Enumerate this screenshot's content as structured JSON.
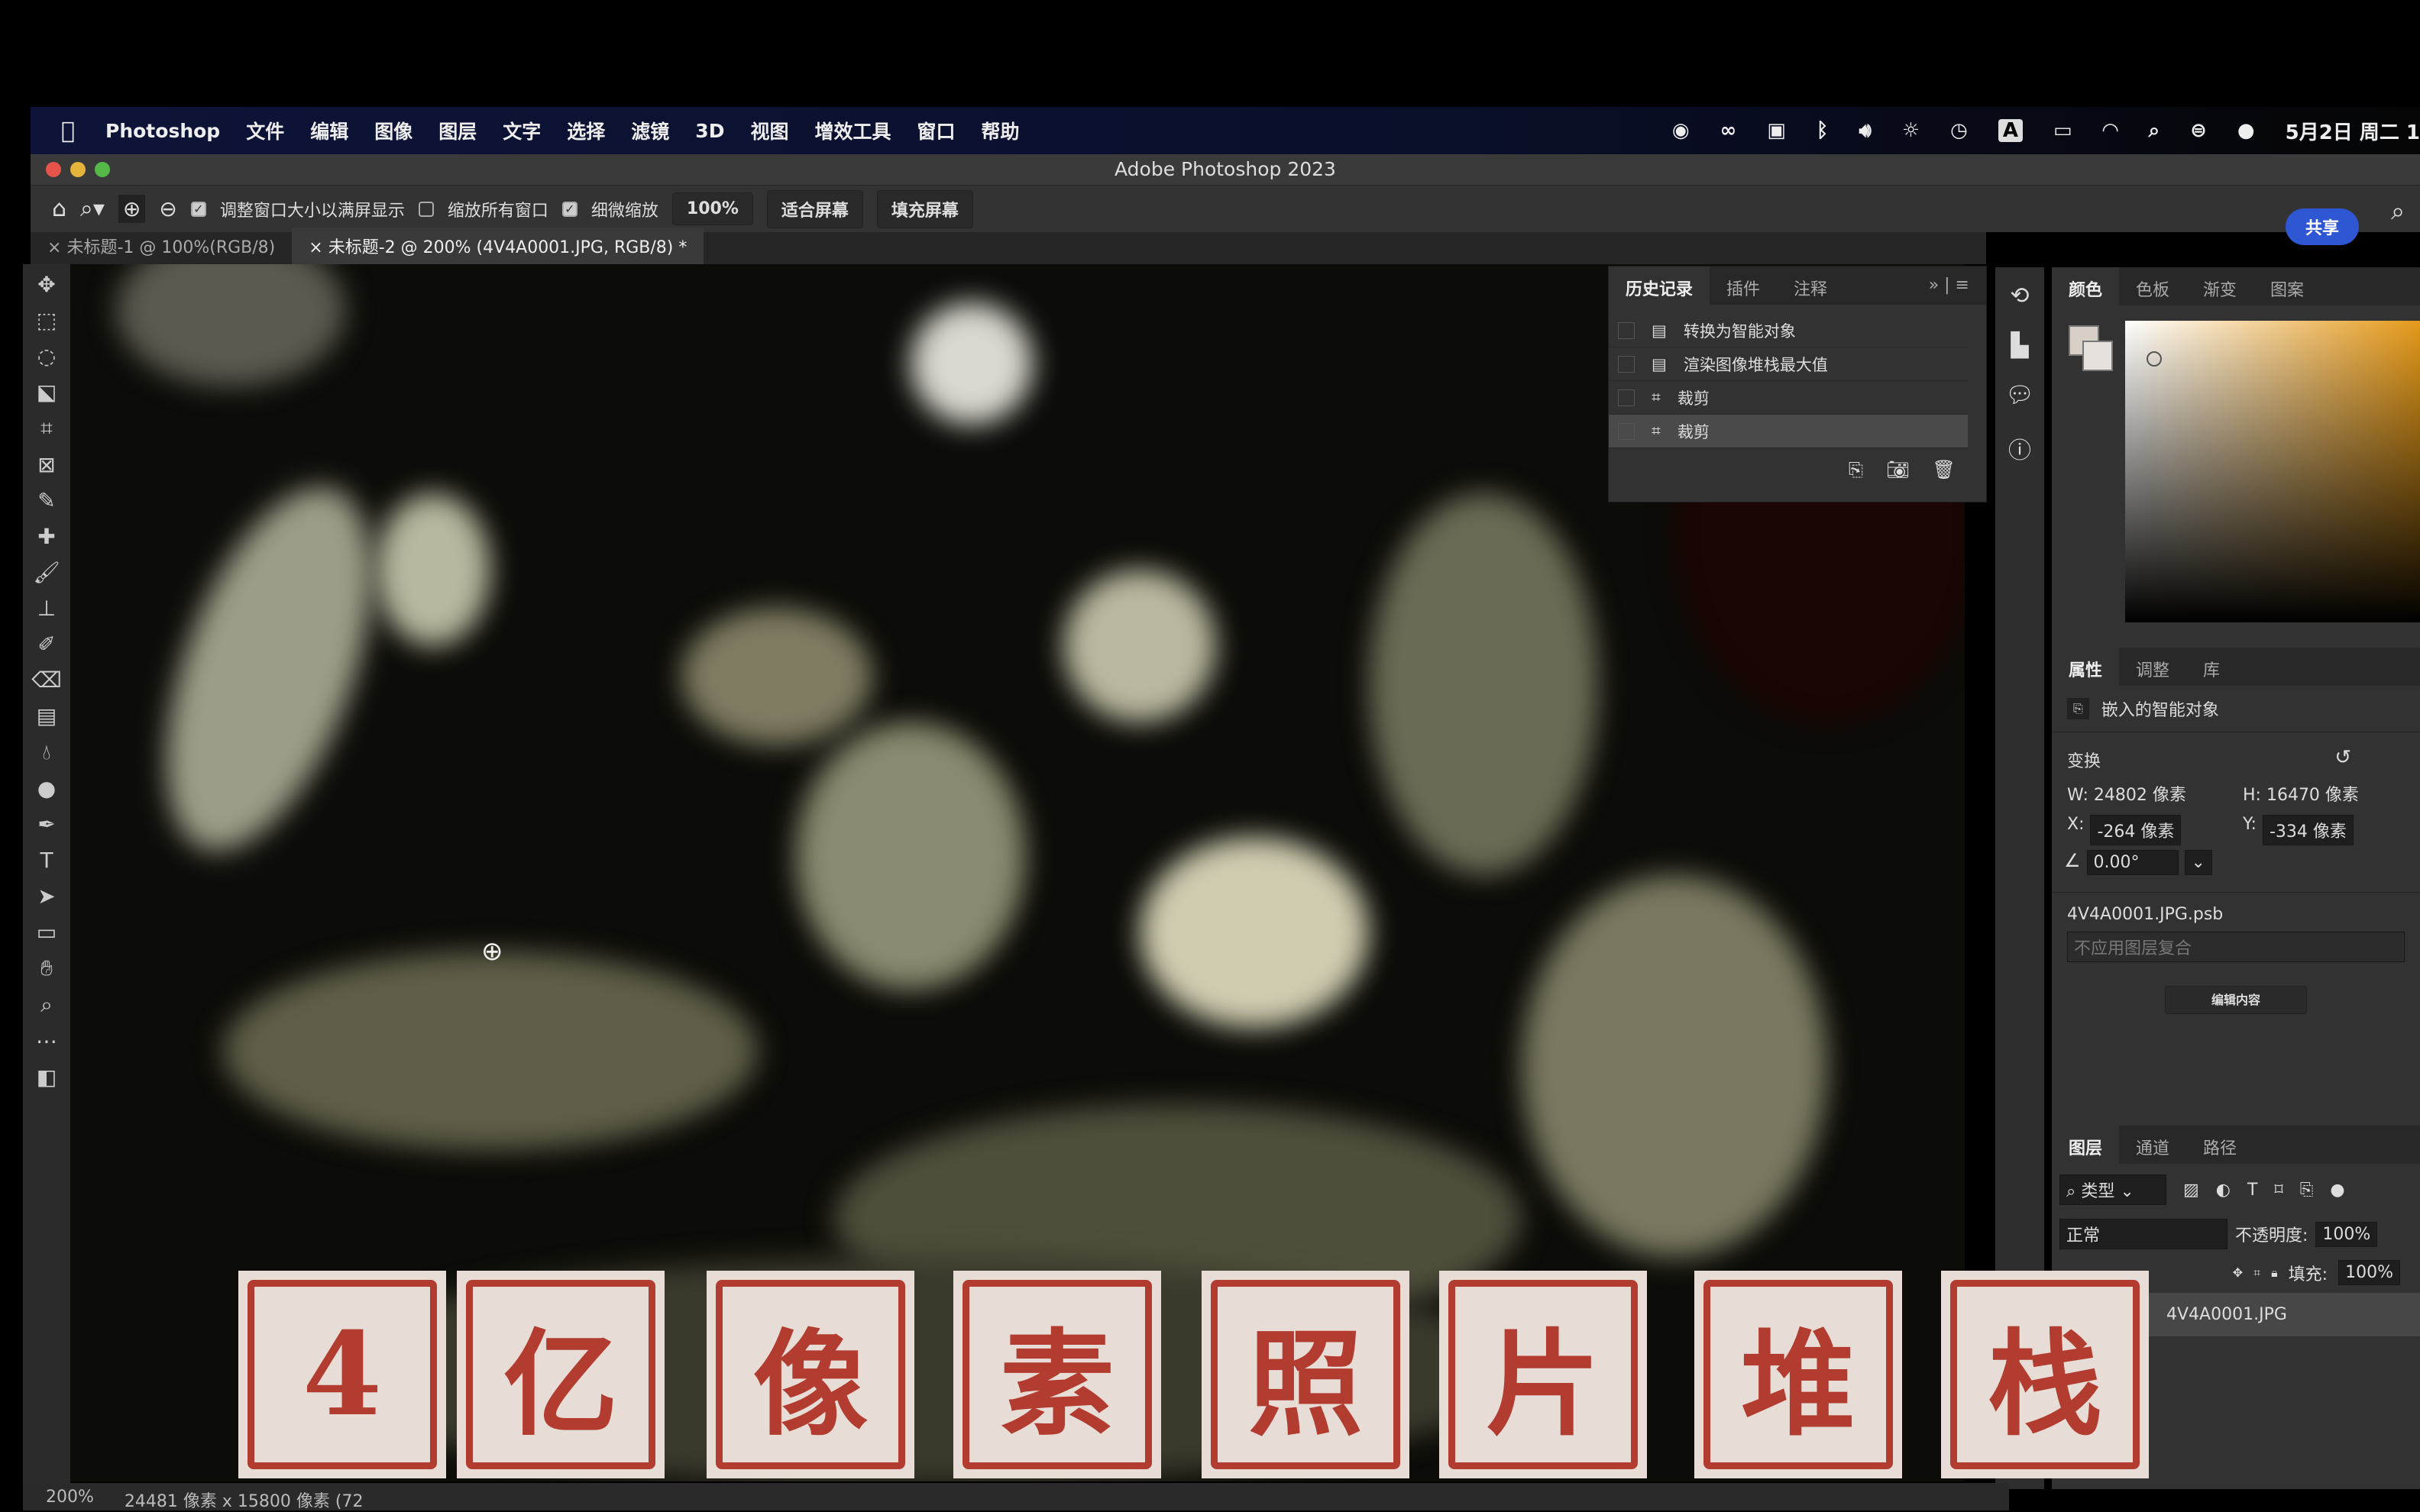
{
  "menubar": {
    "apple": "",
    "app": "Photoshop",
    "items": [
      "文件",
      "编辑",
      "图像",
      "图层",
      "文字",
      "选择",
      "滤镜",
      "3D",
      "视图",
      "增效工具",
      "窗口",
      "帮助"
    ],
    "clock": "5月2日 周二 1",
    "tray_icons": [
      "wechat-icon",
      "creative-cloud-icon",
      "screen-icon",
      "bluetooth-icon",
      "volume-icon",
      "brightness-icon",
      "time-machine-icon",
      "input-source-icon",
      "battery-icon",
      "wifi-icon",
      "spotlight-icon",
      "control-center-icon",
      "siri-icon"
    ],
    "input_letter": "A"
  },
  "window": {
    "title": "Adobe Photoshop 2023"
  },
  "options": {
    "resize_windows": "调整窗口大小以满屏显示",
    "zoom_all": "缩放所有窗口",
    "scrubby": "细微缩放",
    "zoom": "100%",
    "fit": "适合屏幕",
    "fill": "填充屏幕",
    "share": "共享"
  },
  "tabs": [
    {
      "label": "未标题-1 @ 100%(RGB/8)"
    },
    {
      "label": "未标题-2 @ 200% (4V4A0001.JPG, RGB/8) *"
    }
  ],
  "history": {
    "tabs": [
      "历史记录",
      "插件",
      "注释"
    ],
    "items": [
      "转换为智能对象",
      "渲染图像堆栈最大值",
      "裁剪",
      "裁剪"
    ]
  },
  "color": {
    "tabs": [
      "颜色",
      "色板",
      "渐变",
      "图案"
    ],
    "fg": "#d8cfc6",
    "bg": "#e6e1dc"
  },
  "properties": {
    "tabs": [
      "属性",
      "调整",
      "库"
    ],
    "type": "嵌入的智能对象",
    "transform": "变换",
    "w": "W: 24802 像素",
    "h": "H: 16470 像素",
    "x_label": "X:",
    "x": "-264 像素",
    "y_label": "Y:",
    "y": "-334 像素",
    "angle": "0.00°",
    "file": "4V4A0001.JPG.psb",
    "comp": "不应用图层复合",
    "edit": "编辑内容"
  },
  "layers": {
    "tabs": [
      "图层",
      "通道",
      "路径"
    ],
    "filter": "类型",
    "blend": "正常",
    "opacity_label": "不透明度:",
    "opacity": "100%",
    "fill_label": "填充:",
    "fill": "100%",
    "layer": "4V4A0001.JPG"
  },
  "status": {
    "zoom": "200%",
    "size": "24481 像素 x 15800 像素 (72"
  },
  "subtitle": [
    "4",
    "亿",
    "像",
    "素",
    "照",
    "片",
    "堆",
    "栈"
  ],
  "colors": {
    "accent": "#2f56d3",
    "stamp_red": "#b23c2f",
    "stamp_bg": "#e8ddd6"
  }
}
